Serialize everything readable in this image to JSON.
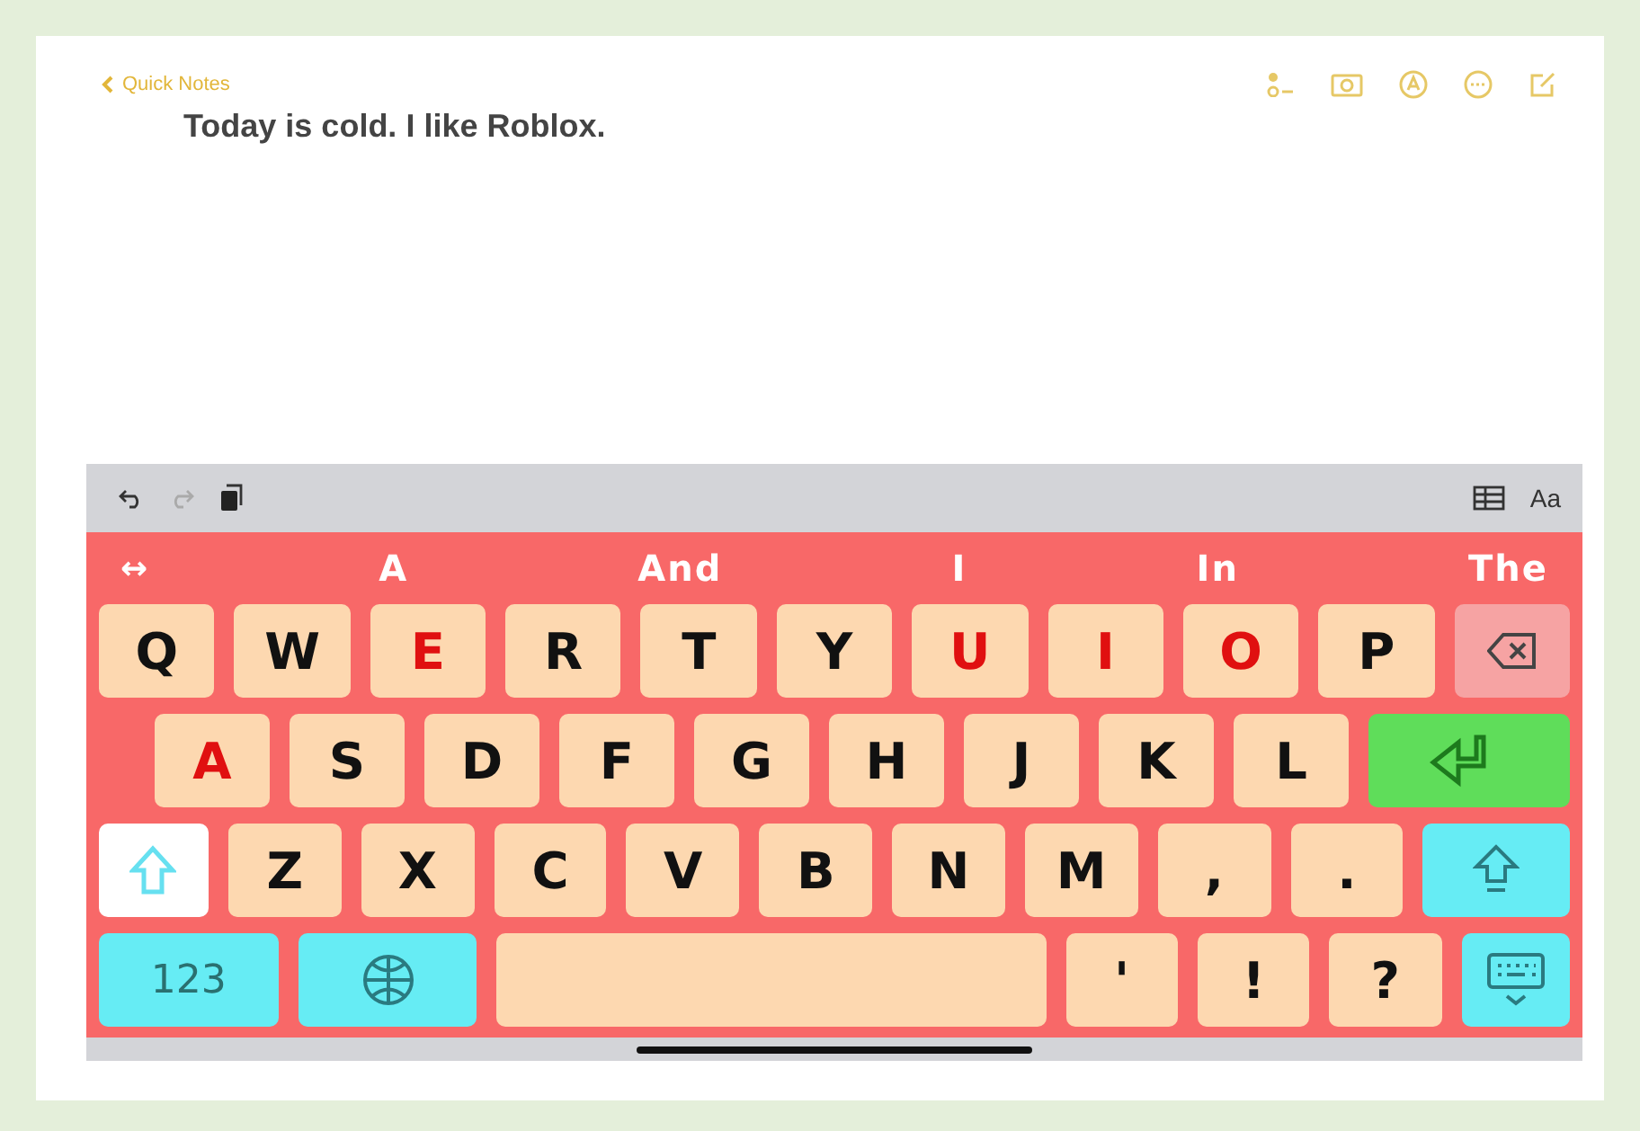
{
  "notes_header": {
    "back_label": "Quick Notes"
  },
  "note_text": "Today is cold.  I like Roblox.",
  "toolbar": {
    "format_label": "Aa"
  },
  "suggestions": [
    "↔",
    "A",
    "And",
    "I",
    "In",
    "The"
  ],
  "keyboard_rows": [
    [
      {
        "kind": "letter",
        "label": "Q",
        "highlighted": false
      },
      {
        "kind": "letter",
        "label": "W",
        "highlighted": false
      },
      {
        "kind": "letter",
        "label": "E",
        "highlighted": true
      },
      {
        "kind": "letter",
        "label": "R",
        "highlighted": false
      },
      {
        "kind": "letter",
        "label": "T",
        "highlighted": false
      },
      {
        "kind": "letter",
        "label": "Y",
        "highlighted": false
      },
      {
        "kind": "letter",
        "label": "U",
        "highlighted": true
      },
      {
        "kind": "letter",
        "label": "I",
        "highlighted": true
      },
      {
        "kind": "letter",
        "label": "O",
        "highlighted": true
      },
      {
        "kind": "letter",
        "label": "P",
        "highlighted": false
      },
      {
        "kind": "delete",
        "color": "#f6a3a3"
      }
    ],
    [
      {
        "kind": "letter",
        "label": "A",
        "highlighted": true
      },
      {
        "kind": "letter",
        "label": "S",
        "highlighted": false
      },
      {
        "kind": "letter",
        "label": "D",
        "highlighted": false
      },
      {
        "kind": "letter",
        "label": "F",
        "highlighted": false
      },
      {
        "kind": "letter",
        "label": "G",
        "highlighted": false
      },
      {
        "kind": "letter",
        "label": "H",
        "highlighted": false
      },
      {
        "kind": "letter",
        "label": "J",
        "highlighted": false
      },
      {
        "kind": "letter",
        "label": "K",
        "highlighted": false
      },
      {
        "kind": "letter",
        "label": "L",
        "highlighted": false
      },
      {
        "kind": "return",
        "color": "#5fdd5a"
      }
    ],
    [
      {
        "kind": "shift",
        "color": "#ffffff"
      },
      {
        "kind": "letter",
        "label": "Z",
        "highlighted": false
      },
      {
        "kind": "letter",
        "label": "X",
        "highlighted": false
      },
      {
        "kind": "letter",
        "label": "C",
        "highlighted": false
      },
      {
        "kind": "letter",
        "label": "V",
        "highlighted": false
      },
      {
        "kind": "letter",
        "label": "B",
        "highlighted": false
      },
      {
        "kind": "letter",
        "label": "N",
        "highlighted": false
      },
      {
        "kind": "letter",
        "label": "M",
        "highlighted": false
      },
      {
        "kind": "letter",
        "label": ",",
        "highlighted": false
      },
      {
        "kind": "letter",
        "label": ".",
        "highlighted": false
      },
      {
        "kind": "capslock",
        "color": "#66ecf4"
      }
    ],
    [
      {
        "kind": "numbers",
        "label": "123",
        "color": "#66ecf4"
      },
      {
        "kind": "globe",
        "color": "#66ecf4"
      },
      {
        "kind": "space"
      },
      {
        "kind": "letter",
        "label": "'",
        "highlighted": false
      },
      {
        "kind": "letter",
        "label": "!",
        "highlighted": false
      },
      {
        "kind": "letter",
        "label": "?",
        "highlighted": false
      },
      {
        "kind": "hide",
        "color": "#66ecf4"
      }
    ]
  ]
}
